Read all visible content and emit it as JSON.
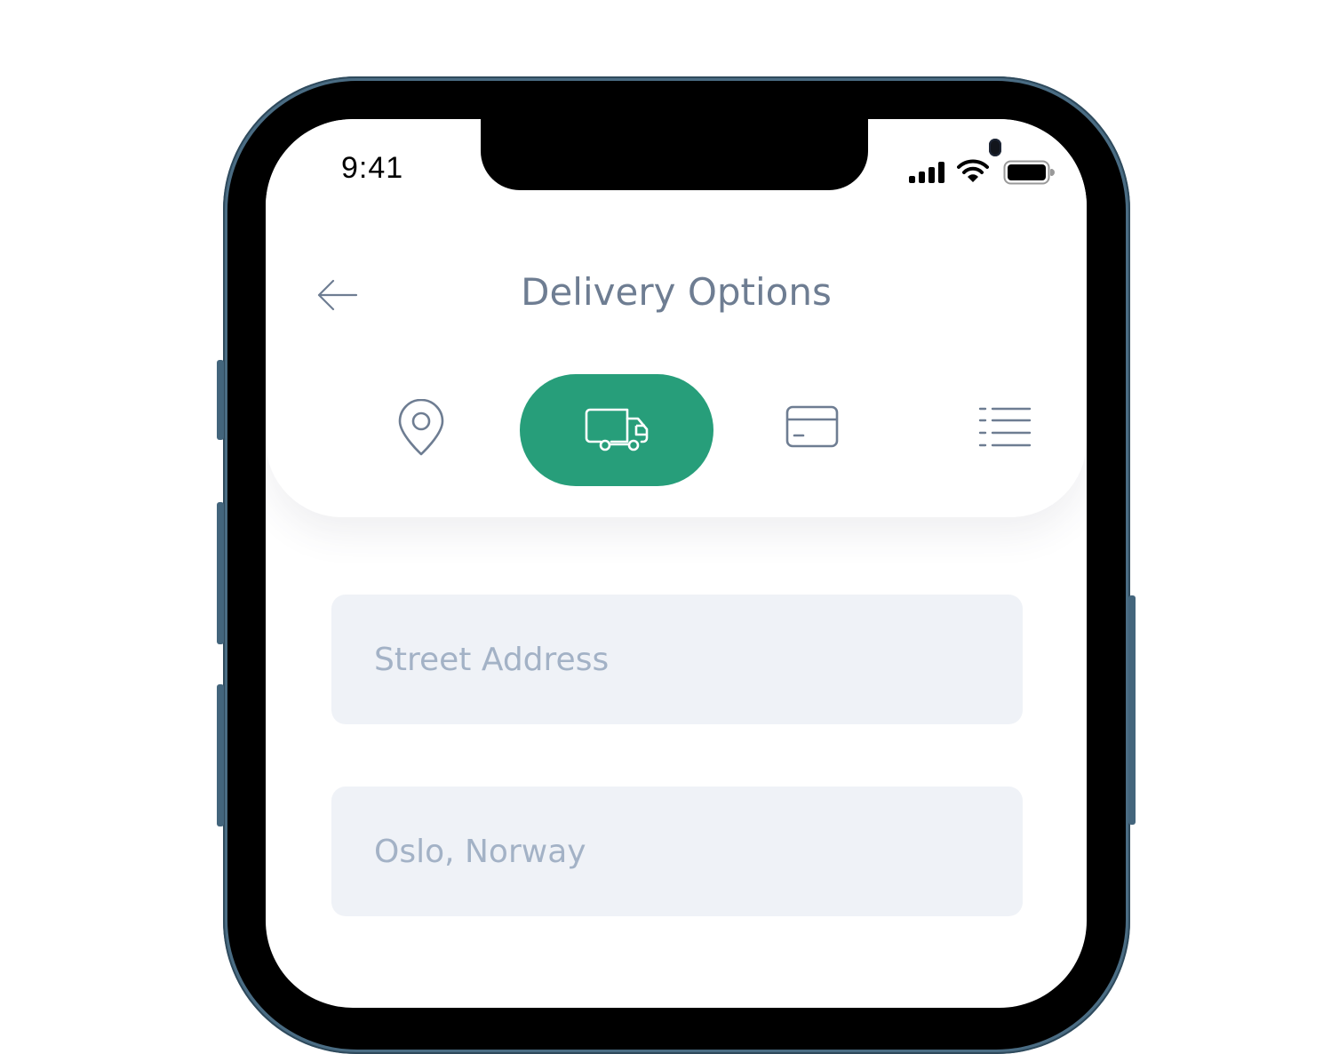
{
  "status_bar": {
    "time": "9:41"
  },
  "header": {
    "title": "Delivery Options"
  },
  "steps": [
    {
      "icon": "location-pin-icon",
      "active": false
    },
    {
      "icon": "truck-icon",
      "active": true
    },
    {
      "icon": "credit-card-icon",
      "active": false
    },
    {
      "icon": "list-icon",
      "active": false
    }
  ],
  "form": {
    "street_placeholder": "Street Address",
    "city_value": "Oslo, Norway"
  },
  "colors": {
    "accent": "#279e7a",
    "title": "#6e7d92",
    "field_bg": "#eff2f7",
    "field_text": "#a3b2c6",
    "icon": "#6e7d92"
  }
}
